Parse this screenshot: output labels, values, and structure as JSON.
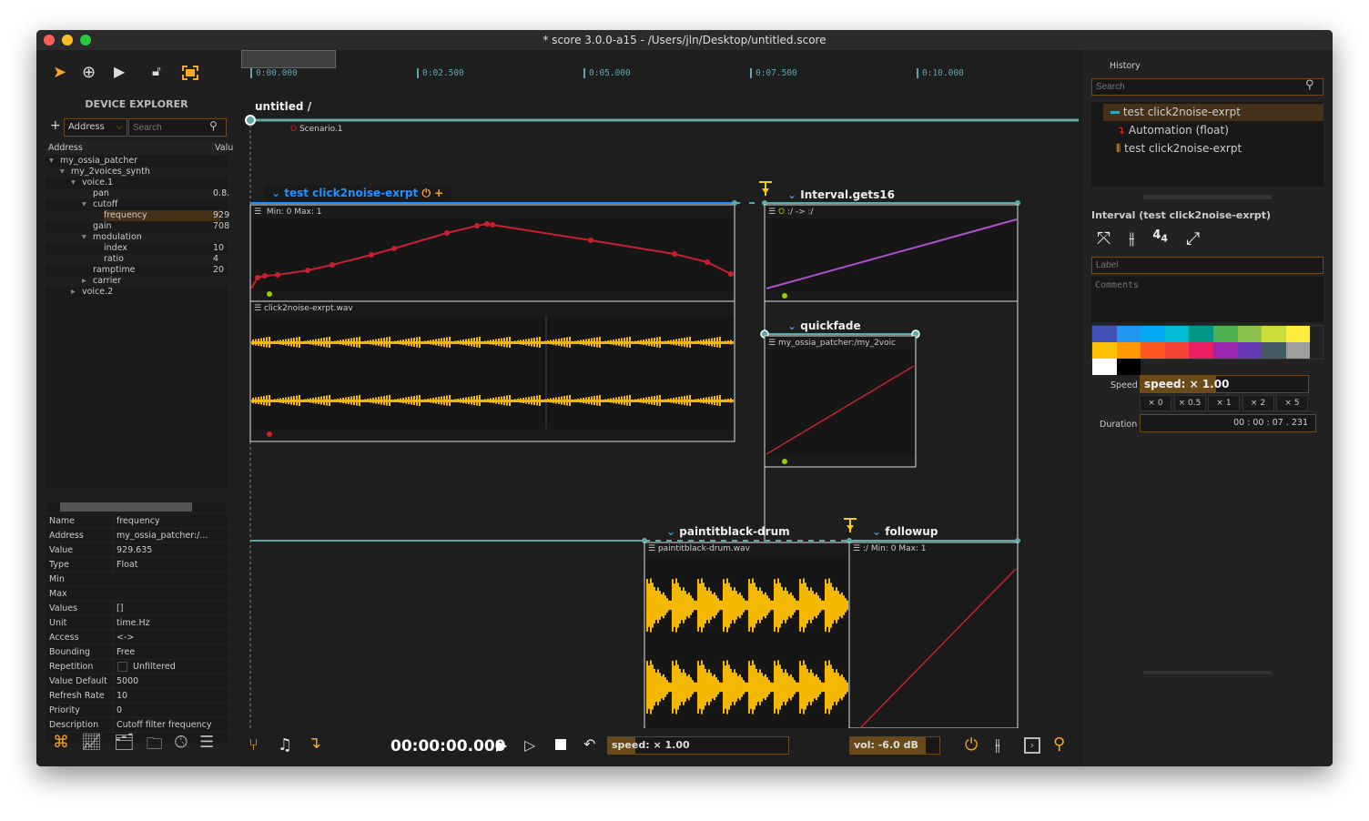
{
  "window": {
    "title": "* score 3.0.0-a15 - /Users/jln/Desktop/untitled.score"
  },
  "toolbar": {
    "icons": [
      "select-arrow-icon",
      "add-circle-icon",
      "play-icon",
      "lock-icon",
      "fullscreen-icon"
    ]
  },
  "device_explorer": {
    "title": "DEVICE EXPLORER",
    "add": "+",
    "address_select": "Address",
    "search_placeholder": "Search",
    "columns": [
      "Address",
      "Valu"
    ],
    "tree": [
      {
        "label": "my_ossia_patcher",
        "indent": 0,
        "arrow": "▾",
        "value": ""
      },
      {
        "label": "my_2voices_synth",
        "indent": 1,
        "arrow": "▾",
        "value": ""
      },
      {
        "label": "voice.1",
        "indent": 2,
        "arrow": "▾",
        "value": ""
      },
      {
        "label": "pan",
        "indent": 3,
        "arrow": "",
        "value": "0.8."
      },
      {
        "label": "cutoff",
        "indent": 3,
        "arrow": "▾",
        "value": ""
      },
      {
        "label": "frequency",
        "indent": 4,
        "arrow": "",
        "value": "929",
        "selected": true
      },
      {
        "label": "gain",
        "indent": 3,
        "arrow": "",
        "value": "708"
      },
      {
        "label": "modulation",
        "indent": 3,
        "arrow": "▾",
        "value": ""
      },
      {
        "label": "index",
        "indent": 4,
        "arrow": "",
        "value": "10"
      },
      {
        "label": "ratio",
        "indent": 4,
        "arrow": "",
        "value": "4"
      },
      {
        "label": "ramptime",
        "indent": 3,
        "arrow": "",
        "value": "20"
      },
      {
        "label": "carrier",
        "indent": 3,
        "arrow": "▸",
        "value": ""
      },
      {
        "label": "voice.2",
        "indent": 2,
        "arrow": "▸",
        "value": ""
      }
    ],
    "properties": [
      {
        "k": "Name",
        "v": "frequency"
      },
      {
        "k": "Address",
        "v": "my_ossia_patcher:/..."
      },
      {
        "k": "Value",
        "v": "929.635"
      },
      {
        "k": "Type",
        "v": "Float"
      },
      {
        "k": "Min",
        "v": ""
      },
      {
        "k": "Max",
        "v": ""
      },
      {
        "k": "Values",
        "v": "[]"
      },
      {
        "k": "Unit",
        "v": "time.Hz"
      },
      {
        "k": "Access",
        "v": "<->"
      },
      {
        "k": "Bounding",
        "v": "Free"
      },
      {
        "k": "Repetition",
        "v": "Unfiltered",
        "checkbox": false
      },
      {
        "k": "Value Default",
        "v": "5000"
      },
      {
        "k": "Refresh Rate",
        "v": "10"
      },
      {
        "k": "Priority",
        "v": "0"
      },
      {
        "k": "Description",
        "v": "Cutoff filter frequency"
      }
    ]
  },
  "timeline": {
    "ticks": [
      "0:00.000",
      "0:02.500",
      "0:05.000",
      "0:07.500",
      "0:10.000"
    ]
  },
  "scenario": {
    "breadcrumb": "untitled /",
    "name": "Scenario.1",
    "intervals": {
      "test": {
        "title": "test click2noise-exrpt",
        "header": "Min: 0  Max: 1",
        "audio": "click2noise-exrpt.wav"
      },
      "gets": {
        "title": "Interval.gets16",
        "header": ":/ -> :/"
      },
      "quickfade": {
        "title": "quickfade",
        "header": "my_ossia_patcher:/my_2voic"
      },
      "paint": {
        "title": "paintitblack-drum",
        "header": "paintitblack-drum.wav"
      },
      "followup": {
        "title": "followup",
        "header": ":/  Min: 0  Max: 1"
      }
    }
  },
  "transport": {
    "time": "00:00:00.000",
    "speed": "speed: × 1.00",
    "speed_fraction": 0.15,
    "vol": "vol: -6.0 dB",
    "vol_fraction": 0.85
  },
  "history": {
    "title": "History",
    "search_placeholder": "Search",
    "items": [
      "test click2noise-exrpt",
      "Automation (float)",
      "test click2noise-exrpt"
    ]
  },
  "inspector": {
    "title": "Interval (test click2noise-exrpt)",
    "label_placeholder": "Label",
    "comments_placeholder": "Comments",
    "colors": [
      "#3f51b5",
      "#2196f3",
      "#03a9f4",
      "#00bcd4",
      "#009688",
      "#4caf50",
      "#8bc34a",
      "#cddc39",
      "#ffeb3b",
      "#ffc107",
      "#ff9800",
      "#ff5722",
      "#f44336",
      "#e91e63",
      "#9c27b0",
      "#673ab7",
      "#455a64",
      "#9e9e9e",
      "#ffffff",
      "#000000"
    ],
    "speed_label": "Speed",
    "speed": "speed: × 1.00",
    "speed_fraction": 0.45,
    "multipliers": [
      "× 0",
      "× 0.5",
      "× 1",
      "× 2",
      "× 5"
    ],
    "duration_label": "Duration",
    "duration": "00 : 00 : 07  .   231"
  },
  "colors": {
    "accent": "#f5a623",
    "interval": "#5fa8a8",
    "selected": "#1e90ff",
    "automation": "#c8202e",
    "audio": "#f5b800",
    "purple": "#b050d0"
  }
}
